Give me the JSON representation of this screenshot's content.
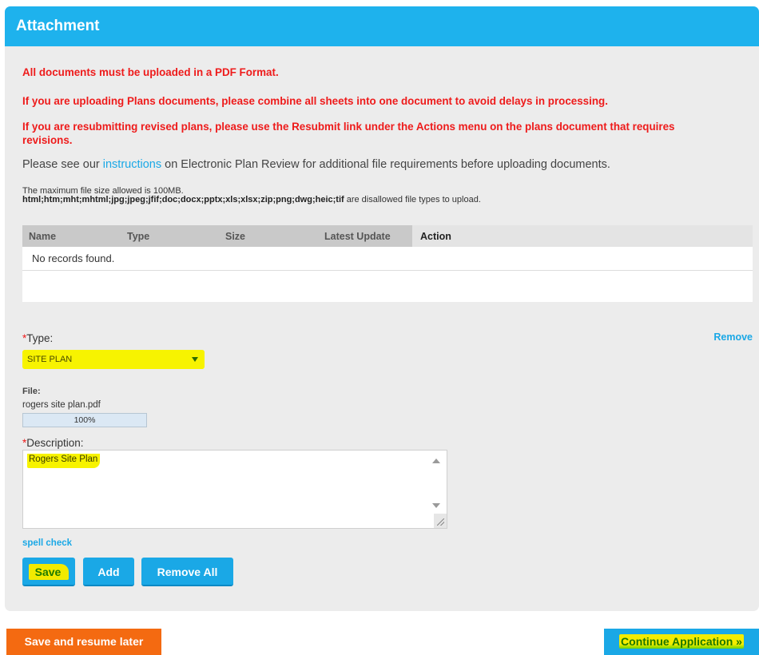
{
  "panel": {
    "title": "Attachment"
  },
  "notices": {
    "pdf_format": "All documents must be uploaded in a PDF Format.",
    "combine_sheets": "If you are uploading Plans documents, please combine all sheets into one document to avoid delays in processing.",
    "resubmit": "If you are resubmitting revised plans, please use the Resubmit link under the Actions menu on the plans document that requires revisions."
  },
  "instructions": {
    "before": "Please see our ",
    "link": "instructions",
    "after": " on Electronic Plan Review for additional file requirements before uploading documents."
  },
  "limits": {
    "max_size": "The maximum file size allowed is 100MB.",
    "disallowed_types": "html;htm;mht;mhtml;jpg;jpeg;jfif;doc;docx;pptx;xls;xlsx;zip;png;dwg;heic;tif",
    "disallowed_suffix": " are disallowed file types to upload."
  },
  "table": {
    "columns": [
      "Name",
      "Type",
      "Size",
      "Latest Update",
      "Action"
    ],
    "empty_message": "No records found."
  },
  "form": {
    "required_mark": "*",
    "type_label": "Type:",
    "type_value": "SITE PLAN",
    "remove_link": "Remove",
    "file_label": "File:",
    "file_name": "rogers site plan.pdf",
    "upload_progress": 100,
    "upload_progress_text": "100%",
    "description_label": "Description:",
    "description_value": "Rogers Site Plan",
    "spell_check": "spell check"
  },
  "buttons": {
    "save": "Save",
    "add": "Add",
    "remove_all": "Remove All",
    "save_resume": "Save and resume later",
    "continue": "Continue Application »"
  },
  "colors": {
    "header_blue": "#1eb2ed",
    "notice_red": "#ee1b1b",
    "button_blue": "#1aa8e6",
    "button_orange": "#f46a11",
    "highlight_yellow": "#f7f300"
  }
}
